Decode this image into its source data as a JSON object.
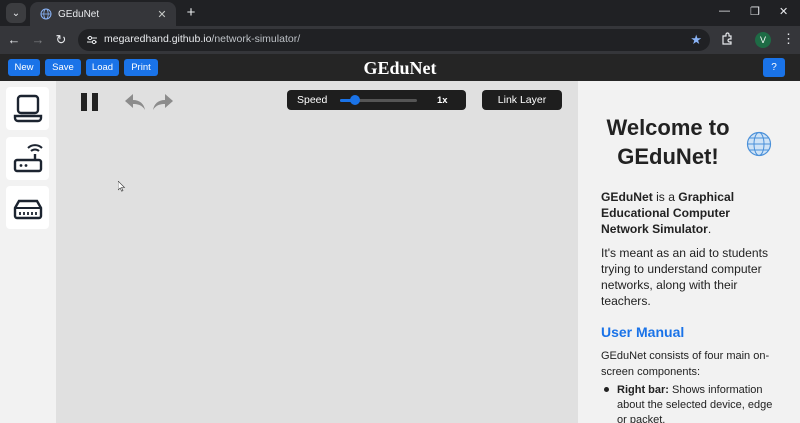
{
  "browser": {
    "tab_title": "GEduNet",
    "url_host": "megaredhand.github.io",
    "url_path": "/network-simulator/",
    "profile_initial": "V"
  },
  "header": {
    "buttons": [
      "New",
      "Save",
      "Load",
      "Print"
    ],
    "title": "GEduNet",
    "help_label": "?"
  },
  "left_toolbar": {
    "devices": [
      "laptop-icon",
      "router-icon",
      "switch-icon"
    ]
  },
  "canvas_controls": {
    "speed_label": "Speed",
    "speed_value": "1x",
    "speed_slider_position": 0.2,
    "link_layer_label": "Link Layer"
  },
  "right_bar": {
    "welcome_line1": "Welcome to",
    "welcome_line2": "GEduNet!",
    "intro_lines": [
      [
        "GEduNet",
        " is a ",
        "Graphical"
      ],
      [
        "Educational Computer"
      ],
      [
        "Network Simulator",
        "."
      ]
    ],
    "purpose_lines": [
      "It's meant as an aid to students",
      "trying to understand computer",
      "networks, along with their",
      "teachers."
    ],
    "manual_title": "User Manual",
    "manual_lines": [
      "GEduNet consists of four main on-",
      "screen components:"
    ],
    "bullet_lines": [
      [
        "Right bar:",
        " Shows information"
      ],
      [
        "about the selected device, edge"
      ],
      [
        "or packet."
      ]
    ]
  },
  "colors": {
    "accent": "#1a73e8",
    "header_bg": "#252525",
    "canvas_bg": "#e0e0e0",
    "panel_bg": "#f2f2f2"
  }
}
